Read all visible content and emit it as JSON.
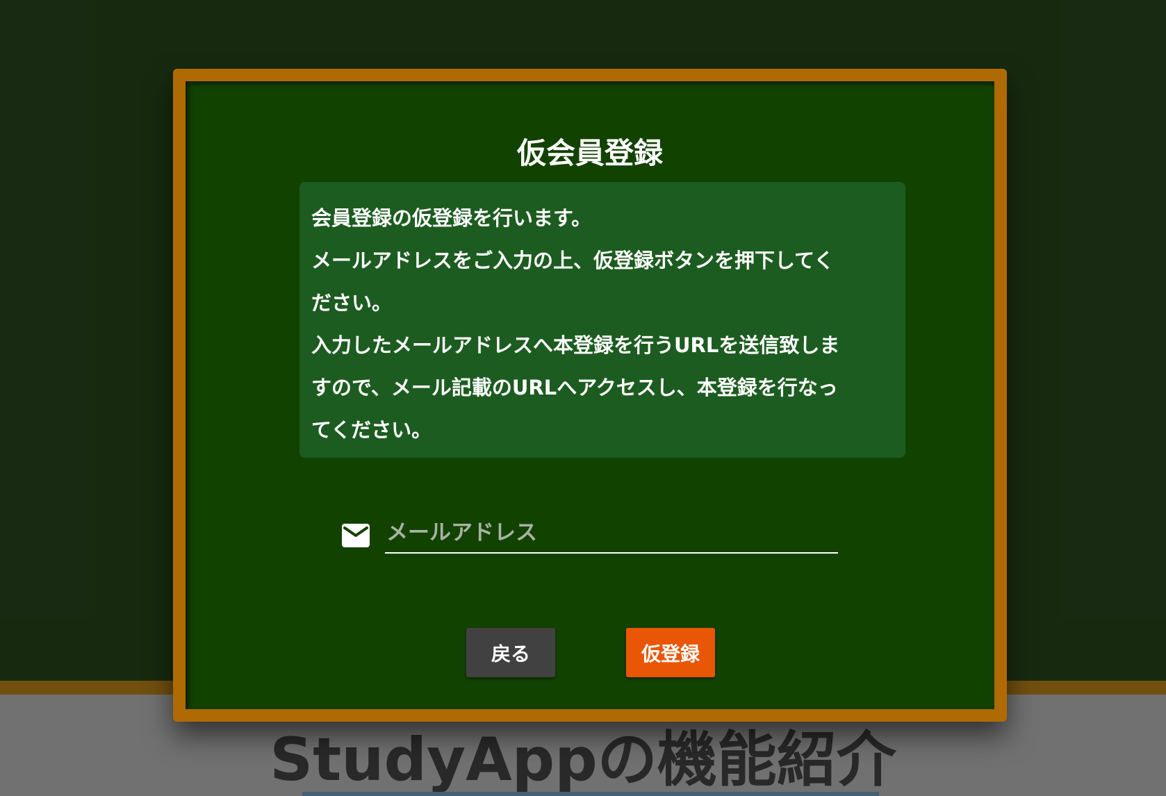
{
  "background": {
    "heading": "StudyAppの機能紹介"
  },
  "modal": {
    "title": "仮会員登録",
    "description_lines": [
      "会員登録の仮登録を行います。",
      "メールアドレスをご入力の上、仮登録ボタンを押下してく",
      "ださい。",
      "入力したメールアドレスへ本登録を行うURLを送信致しま",
      "すので、メール記載のURLへアクセスし、本登録を行なっ",
      "てください。"
    ],
    "email": {
      "icon": "mail-icon",
      "placeholder": "メールアドレス",
      "value": ""
    },
    "buttons": {
      "back_label": "戻る",
      "register_label": "仮登録"
    }
  },
  "colors": {
    "board": "#124200",
    "frame": "#b06a03",
    "info_box": "#1d5c20",
    "back_button": "#414141",
    "register_button": "#e95606"
  }
}
